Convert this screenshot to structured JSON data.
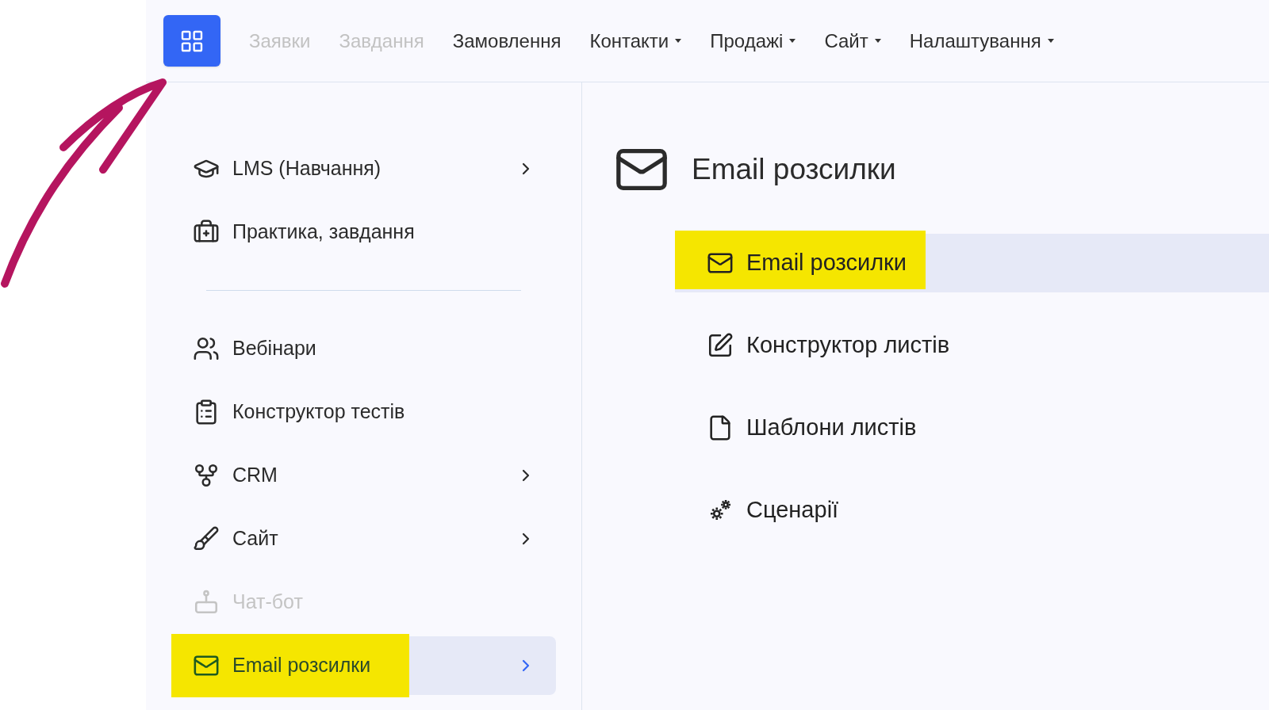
{
  "top_nav": {
    "items": [
      {
        "label": "Заявки",
        "disabled": true,
        "has_dropdown": false
      },
      {
        "label": "Завдання",
        "disabled": true,
        "has_dropdown": false
      },
      {
        "label": "Замовлення",
        "disabled": false,
        "has_dropdown": false
      },
      {
        "label": "Контакти",
        "disabled": false,
        "has_dropdown": true
      },
      {
        "label": "Продажі",
        "disabled": false,
        "has_dropdown": true
      },
      {
        "label": "Сайт",
        "disabled": false,
        "has_dropdown": true
      },
      {
        "label": "Налаштування",
        "disabled": false,
        "has_dropdown": true
      }
    ]
  },
  "sidebar": {
    "items": [
      {
        "kind": "item",
        "label": "LMS (Навчання)",
        "has_submenu": true,
        "disabled": false,
        "selected": false,
        "highlighted": false
      },
      {
        "kind": "item",
        "label": "Практика, завдання",
        "has_submenu": false,
        "disabled": false,
        "selected": false,
        "highlighted": false
      },
      {
        "kind": "divider"
      },
      {
        "kind": "item",
        "label": "Вебінари",
        "has_submenu": false,
        "disabled": false,
        "selected": false,
        "highlighted": false
      },
      {
        "kind": "item",
        "label": "Конструктор тестів",
        "has_submenu": false,
        "disabled": false,
        "selected": false,
        "highlighted": false
      },
      {
        "kind": "item",
        "label": "CRM",
        "has_submenu": true,
        "disabled": false,
        "selected": false,
        "highlighted": false
      },
      {
        "kind": "item",
        "label": "Сайт",
        "has_submenu": true,
        "disabled": false,
        "selected": false,
        "highlighted": false
      },
      {
        "kind": "item",
        "label": "Чат-бот",
        "has_submenu": false,
        "disabled": true,
        "selected": false,
        "highlighted": false
      },
      {
        "kind": "item",
        "label": "Email розсилки",
        "has_submenu": true,
        "disabled": false,
        "selected": true,
        "highlighted": true
      }
    ]
  },
  "submenu": {
    "title": "Email розсилки",
    "items": [
      {
        "label": "Email розсилки",
        "selected": true,
        "highlighted": true
      },
      {
        "label": "Конструктор листів",
        "selected": false,
        "highlighted": false
      },
      {
        "label": "Шаблони листів",
        "selected": false,
        "highlighted": false
      },
      {
        "label": "Сценарії",
        "selected": false,
        "highlighted": false
      }
    ]
  }
}
